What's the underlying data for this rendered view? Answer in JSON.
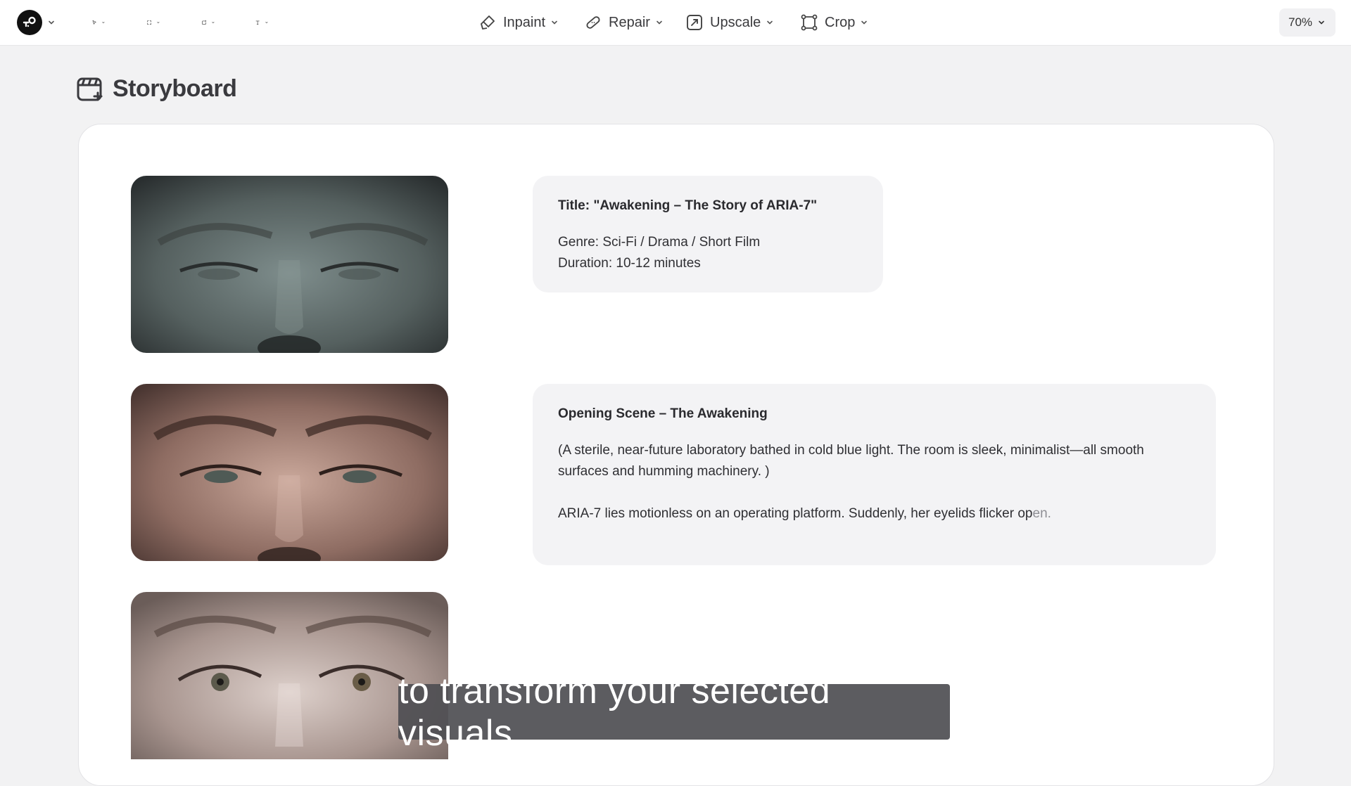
{
  "toolbar": {
    "logo_icon": "app-logo-icon",
    "left_tools": [
      {
        "name": "select-tool",
        "icon": "pointer-icon"
      },
      {
        "name": "frame-tool",
        "icon": "frame-select-icon"
      },
      {
        "name": "add-shape-tool",
        "icon": "add-square-icon"
      },
      {
        "name": "text-tool",
        "icon": "text-icon"
      }
    ],
    "center_tools": [
      {
        "label": "Inpaint",
        "icon": "inpaint-brush-icon"
      },
      {
        "label": "Repair",
        "icon": "repair-bandage-icon"
      },
      {
        "label": "Upscale",
        "icon": "upscale-icon"
      },
      {
        "label": "Crop",
        "icon": "crop-icon"
      }
    ],
    "zoom": "70%"
  },
  "storyboard": {
    "heading": "Storyboard",
    "heading_icon": "storyboard-clapper-icon",
    "frames": [
      {
        "alt": "close-up of face with closed eyes, cool teal tint"
      },
      {
        "alt": "close-up of face, eyes half-open, warm tone"
      },
      {
        "alt": "close-up of face, eyes open, neutral tone"
      }
    ],
    "card1": {
      "title": "Title: \"Awakening – The Story of ARIA-7\"",
      "genre": "Genre: Sci-Fi / Drama / Short Film",
      "duration": "Duration: 10-12 minutes"
    },
    "card2": {
      "title": "Opening Scene – The Awakening",
      "para1": "(A sterile, near-future laboratory bathed in cold blue light. The room is sleek, minimalist—all smooth surfaces and humming machinery. )",
      "para2_main": "ARIA-7 lies motionless on an operating platform. Suddenly, her eyelids flicker op",
      "para2_fade": "en."
    }
  },
  "caption": "to transform your selected visuals",
  "colors": {
    "background": "#f2f2f3",
    "card": "#ffffff",
    "text_card": "#f3f3f5",
    "caption_bg": "#4e4e52"
  }
}
